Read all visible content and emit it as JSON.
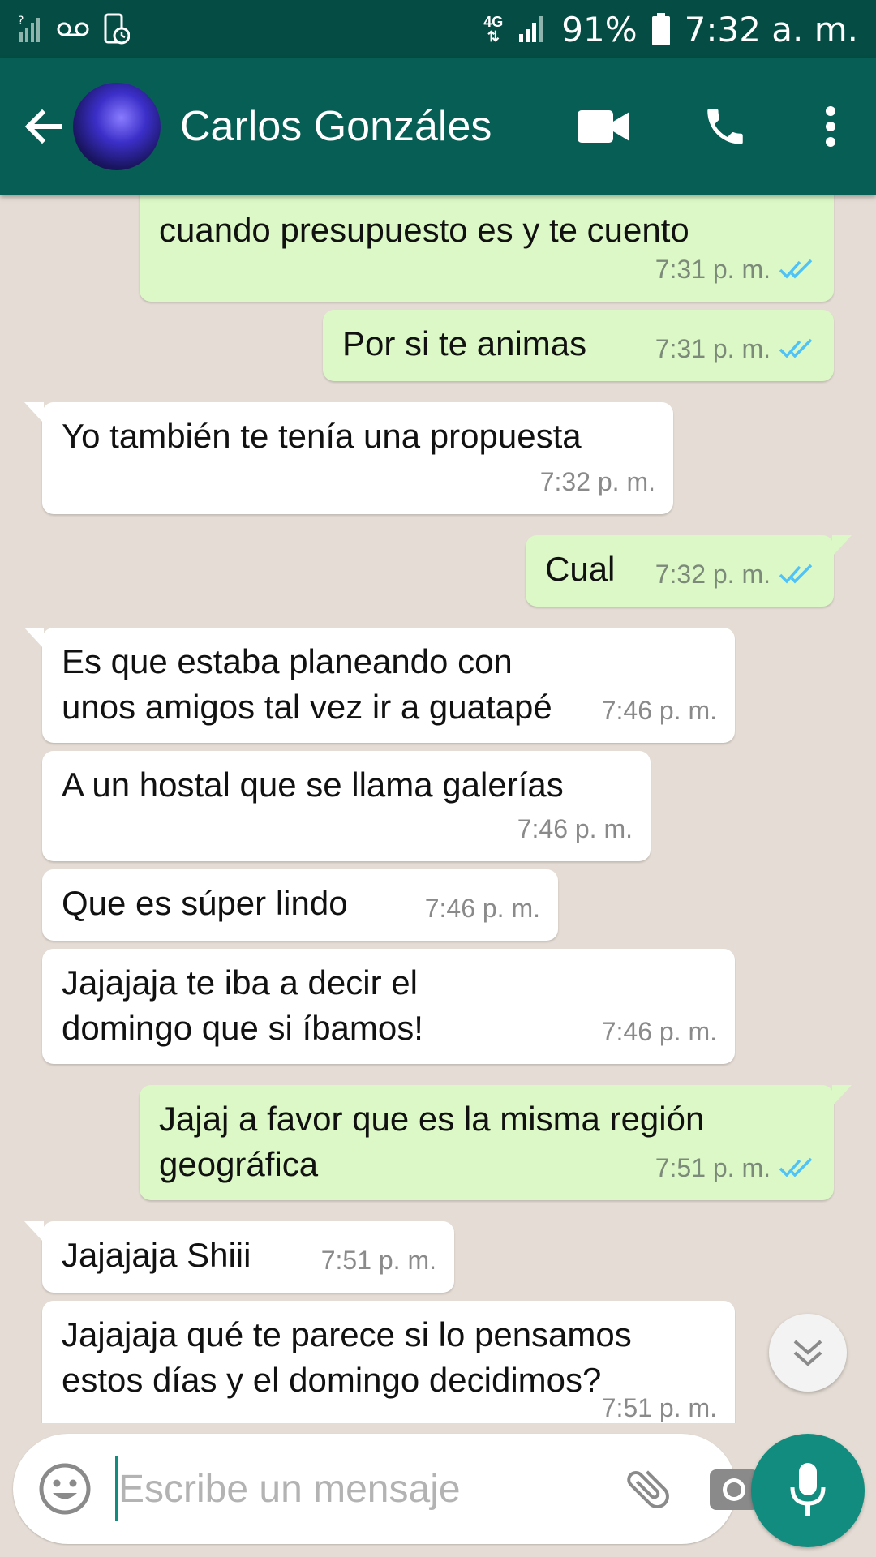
{
  "status_bar": {
    "network": "4G",
    "battery": "91%",
    "time": "7:32 a. m."
  },
  "header": {
    "contact_name": "Carlos Gonzáles"
  },
  "messages": [
    {
      "direction": "out",
      "text": "cuando presupuesto es y te cuento",
      "time": "7:31 p. m.",
      "read": true
    },
    {
      "direction": "out",
      "text": "Por si te animas",
      "time": "7:31 p. m.",
      "read": true
    },
    {
      "direction": "in",
      "text": "Yo también te tenía una propuesta",
      "time": "7:32 p. m."
    },
    {
      "direction": "out",
      "text": "Cual",
      "time": "7:32 p. m.",
      "read": true
    },
    {
      "direction": "in",
      "text": "Es que estaba planeando con unos amigos tal vez ir a guatapé",
      "time": "7:46 p. m."
    },
    {
      "direction": "in",
      "text": "A un hostal que se llama galerías",
      "time": "7:46 p. m."
    },
    {
      "direction": "in",
      "text": "Que es súper lindo",
      "time": "7:46 p. m."
    },
    {
      "direction": "in",
      "text": "Jajajaja te iba a decir el domingo que si íbamos!",
      "time": "7:46 p. m."
    },
    {
      "direction": "out",
      "text": "Jajaj a favor que es la misma región geográfica",
      "time": "7:51 p. m.",
      "read": true
    },
    {
      "direction": "in",
      "text": "Jajajaja Shiii",
      "time": "7:51 p. m."
    },
    {
      "direction": "in",
      "text": "Jajajaja qué te parece si lo pensamos estos días y el domingo decidimos?",
      "time": "7:51 p. m."
    }
  ],
  "composer": {
    "placeholder": "Escribe un mensaje"
  },
  "colors": {
    "header": "#075e54",
    "status_bar": "#054d44",
    "outgoing_bubble": "#dcf8c6",
    "incoming_bubble": "#ffffff",
    "chat_background": "#e5ddd5",
    "accent": "#128c7e",
    "read_ticks": "#4fc3f7"
  },
  "icons": {
    "back": "arrow-left-icon",
    "video": "video-camera-icon",
    "call": "phone-icon",
    "more": "more-vertical-icon",
    "emoji": "emoji-icon",
    "attach": "paperclip-icon",
    "camera": "camera-icon",
    "mic": "microphone-icon",
    "scroll": "chevron-double-down-icon"
  }
}
